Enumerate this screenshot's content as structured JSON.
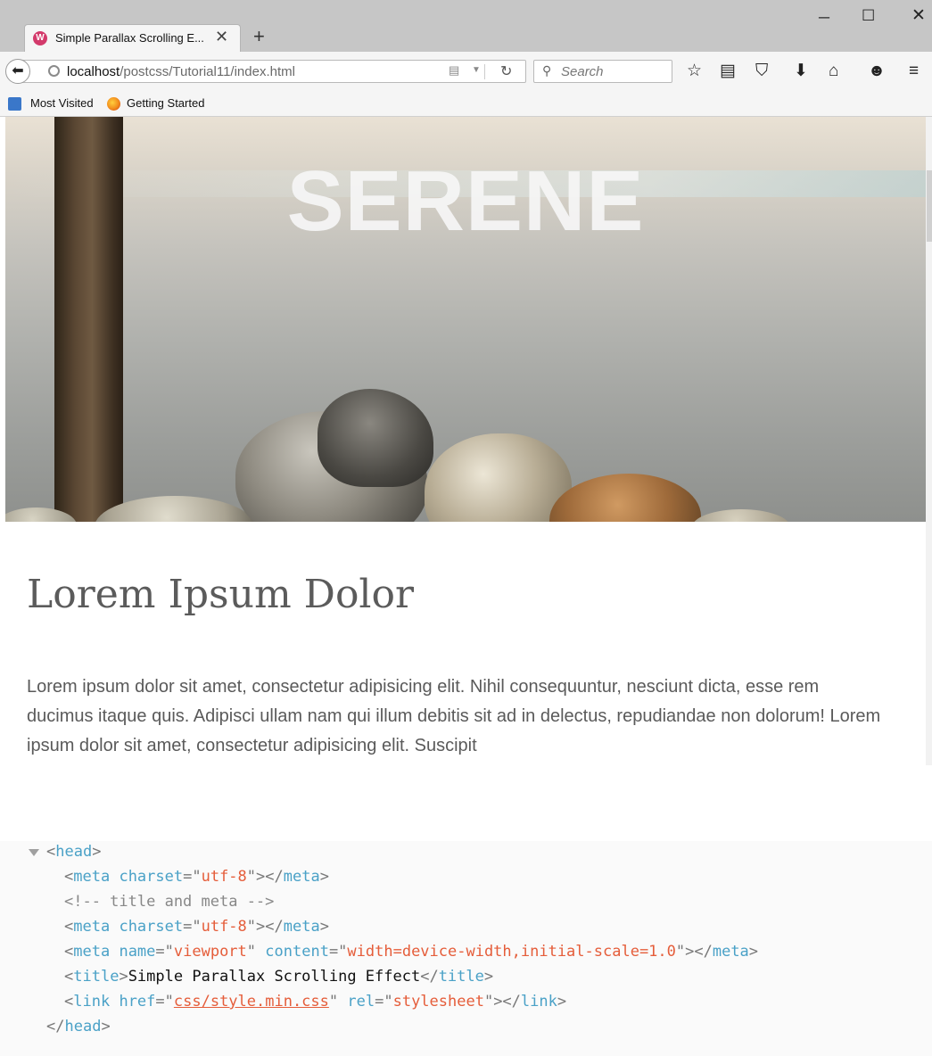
{
  "browser": {
    "tab_title": "Simple Parallax Scrolling E...",
    "tab_favicon_letter": "W",
    "new_tab_label": "+",
    "window_controls": {
      "minimize": "─",
      "maximize": "☐",
      "close": "✕"
    },
    "url_host": "localhost",
    "url_path": "/postcss/Tutorial11/index.html",
    "search_placeholder": "Search",
    "toolbar_icons": [
      "star-icon",
      "reading-list-icon",
      "pocket-icon",
      "download-icon",
      "home-icon",
      "chat-icon",
      "menu-icon"
    ]
  },
  "bookmarks": [
    {
      "label": "Most Visited",
      "icon": "most-visited-icon"
    },
    {
      "label": "Getting Started",
      "icon": "firefox-icon"
    }
  ],
  "page": {
    "hero_title": "SERENE",
    "heading": "Lorem Ipsum Dolor",
    "paragraph": "Lorem ipsum dolor sit amet, consectetur adipisicing elit. Nihil consequuntur, nesciunt dicta, esse rem ducimus itaque quis. Adipisci ullam nam qui illum debitis sit ad in delectus, repudiandae non dolorum! Lorem ipsum dolor sit amet, consectetur adipisicing elit. Suscipit"
  },
  "code": {
    "head_open": "head",
    "meta1_tag": "meta",
    "meta1_attr": "charset",
    "meta1_val": "utf-8",
    "comment": "<!-- title and meta -->",
    "meta2_tag": "meta",
    "meta2_attr": "charset",
    "meta2_val": "utf-8",
    "meta3_tag": "meta",
    "meta3_attr1": "name",
    "meta3_val1": "viewport",
    "meta3_attr2": "content",
    "meta3_val2": "width=device-width,initial-scale=1.0",
    "title_tag": "title",
    "title_text": "Simple Parallax Scrolling Effect",
    "link_tag": "link",
    "link_attr1": "href",
    "link_val1": "css/style.min.css",
    "link_attr2": "rel",
    "link_val2": "stylesheet",
    "head_close": "head"
  },
  "colors": {
    "tag": "#4aa1c7",
    "value": "#e55d3a",
    "heading": "#5b5b5b"
  }
}
